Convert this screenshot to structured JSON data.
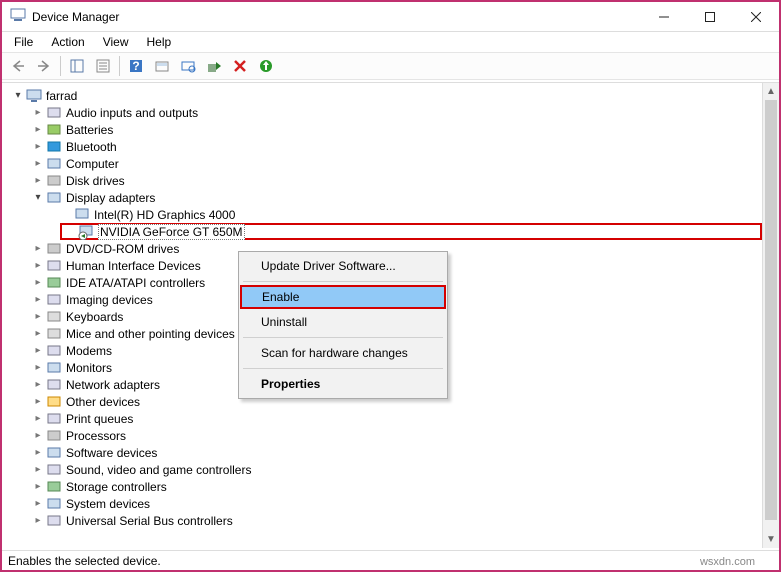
{
  "window": {
    "title": "Device Manager"
  },
  "menu": {
    "file": "File",
    "action": "Action",
    "view": "View",
    "help": "Help"
  },
  "tree": {
    "root": "farrad",
    "items": [
      "Audio inputs and outputs",
      "Batteries",
      "Bluetooth",
      "Computer",
      "Disk drives",
      "Display adapters",
      "DVD/CD-ROM drives",
      "Human Interface Devices",
      "IDE ATA/ATAPI controllers",
      "Imaging devices",
      "Keyboards",
      "Mice and other pointing devices",
      "Modems",
      "Monitors",
      "Network adapters",
      "Other devices",
      "Print queues",
      "Processors",
      "Software devices",
      "Sound, video and game controllers",
      "Storage controllers",
      "System devices",
      "Universal Serial Bus controllers"
    ],
    "display_children": [
      "Intel(R) HD Graphics 4000",
      "NVIDIA GeForce GT 650M"
    ]
  },
  "context_menu": {
    "update": "Update Driver Software...",
    "enable": "Enable",
    "uninstall": "Uninstall",
    "scan": "Scan for hardware changes",
    "properties": "Properties"
  },
  "status": "Enables the selected device.",
  "watermark": "wsxdn.com"
}
